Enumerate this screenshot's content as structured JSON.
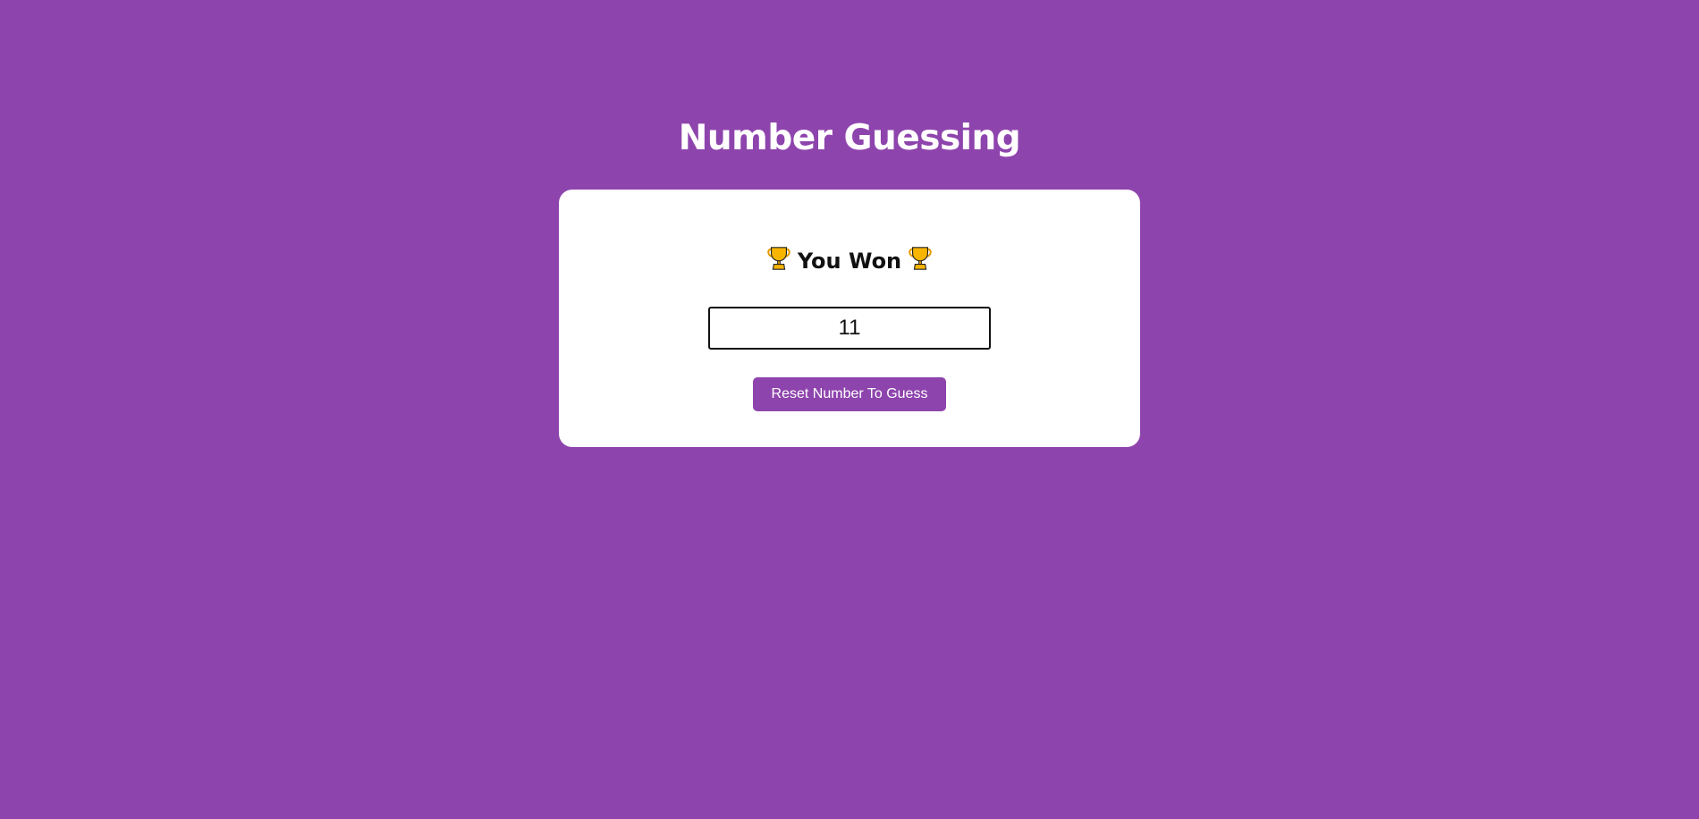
{
  "page": {
    "title": "Number Guessing",
    "background_color": "#8e44ad"
  },
  "game": {
    "result_text": "You Won",
    "result_icon": "trophy-icon",
    "guess_value": "11",
    "reset_label": "Reset Number To Guess",
    "button_color": "#8e44ad"
  }
}
